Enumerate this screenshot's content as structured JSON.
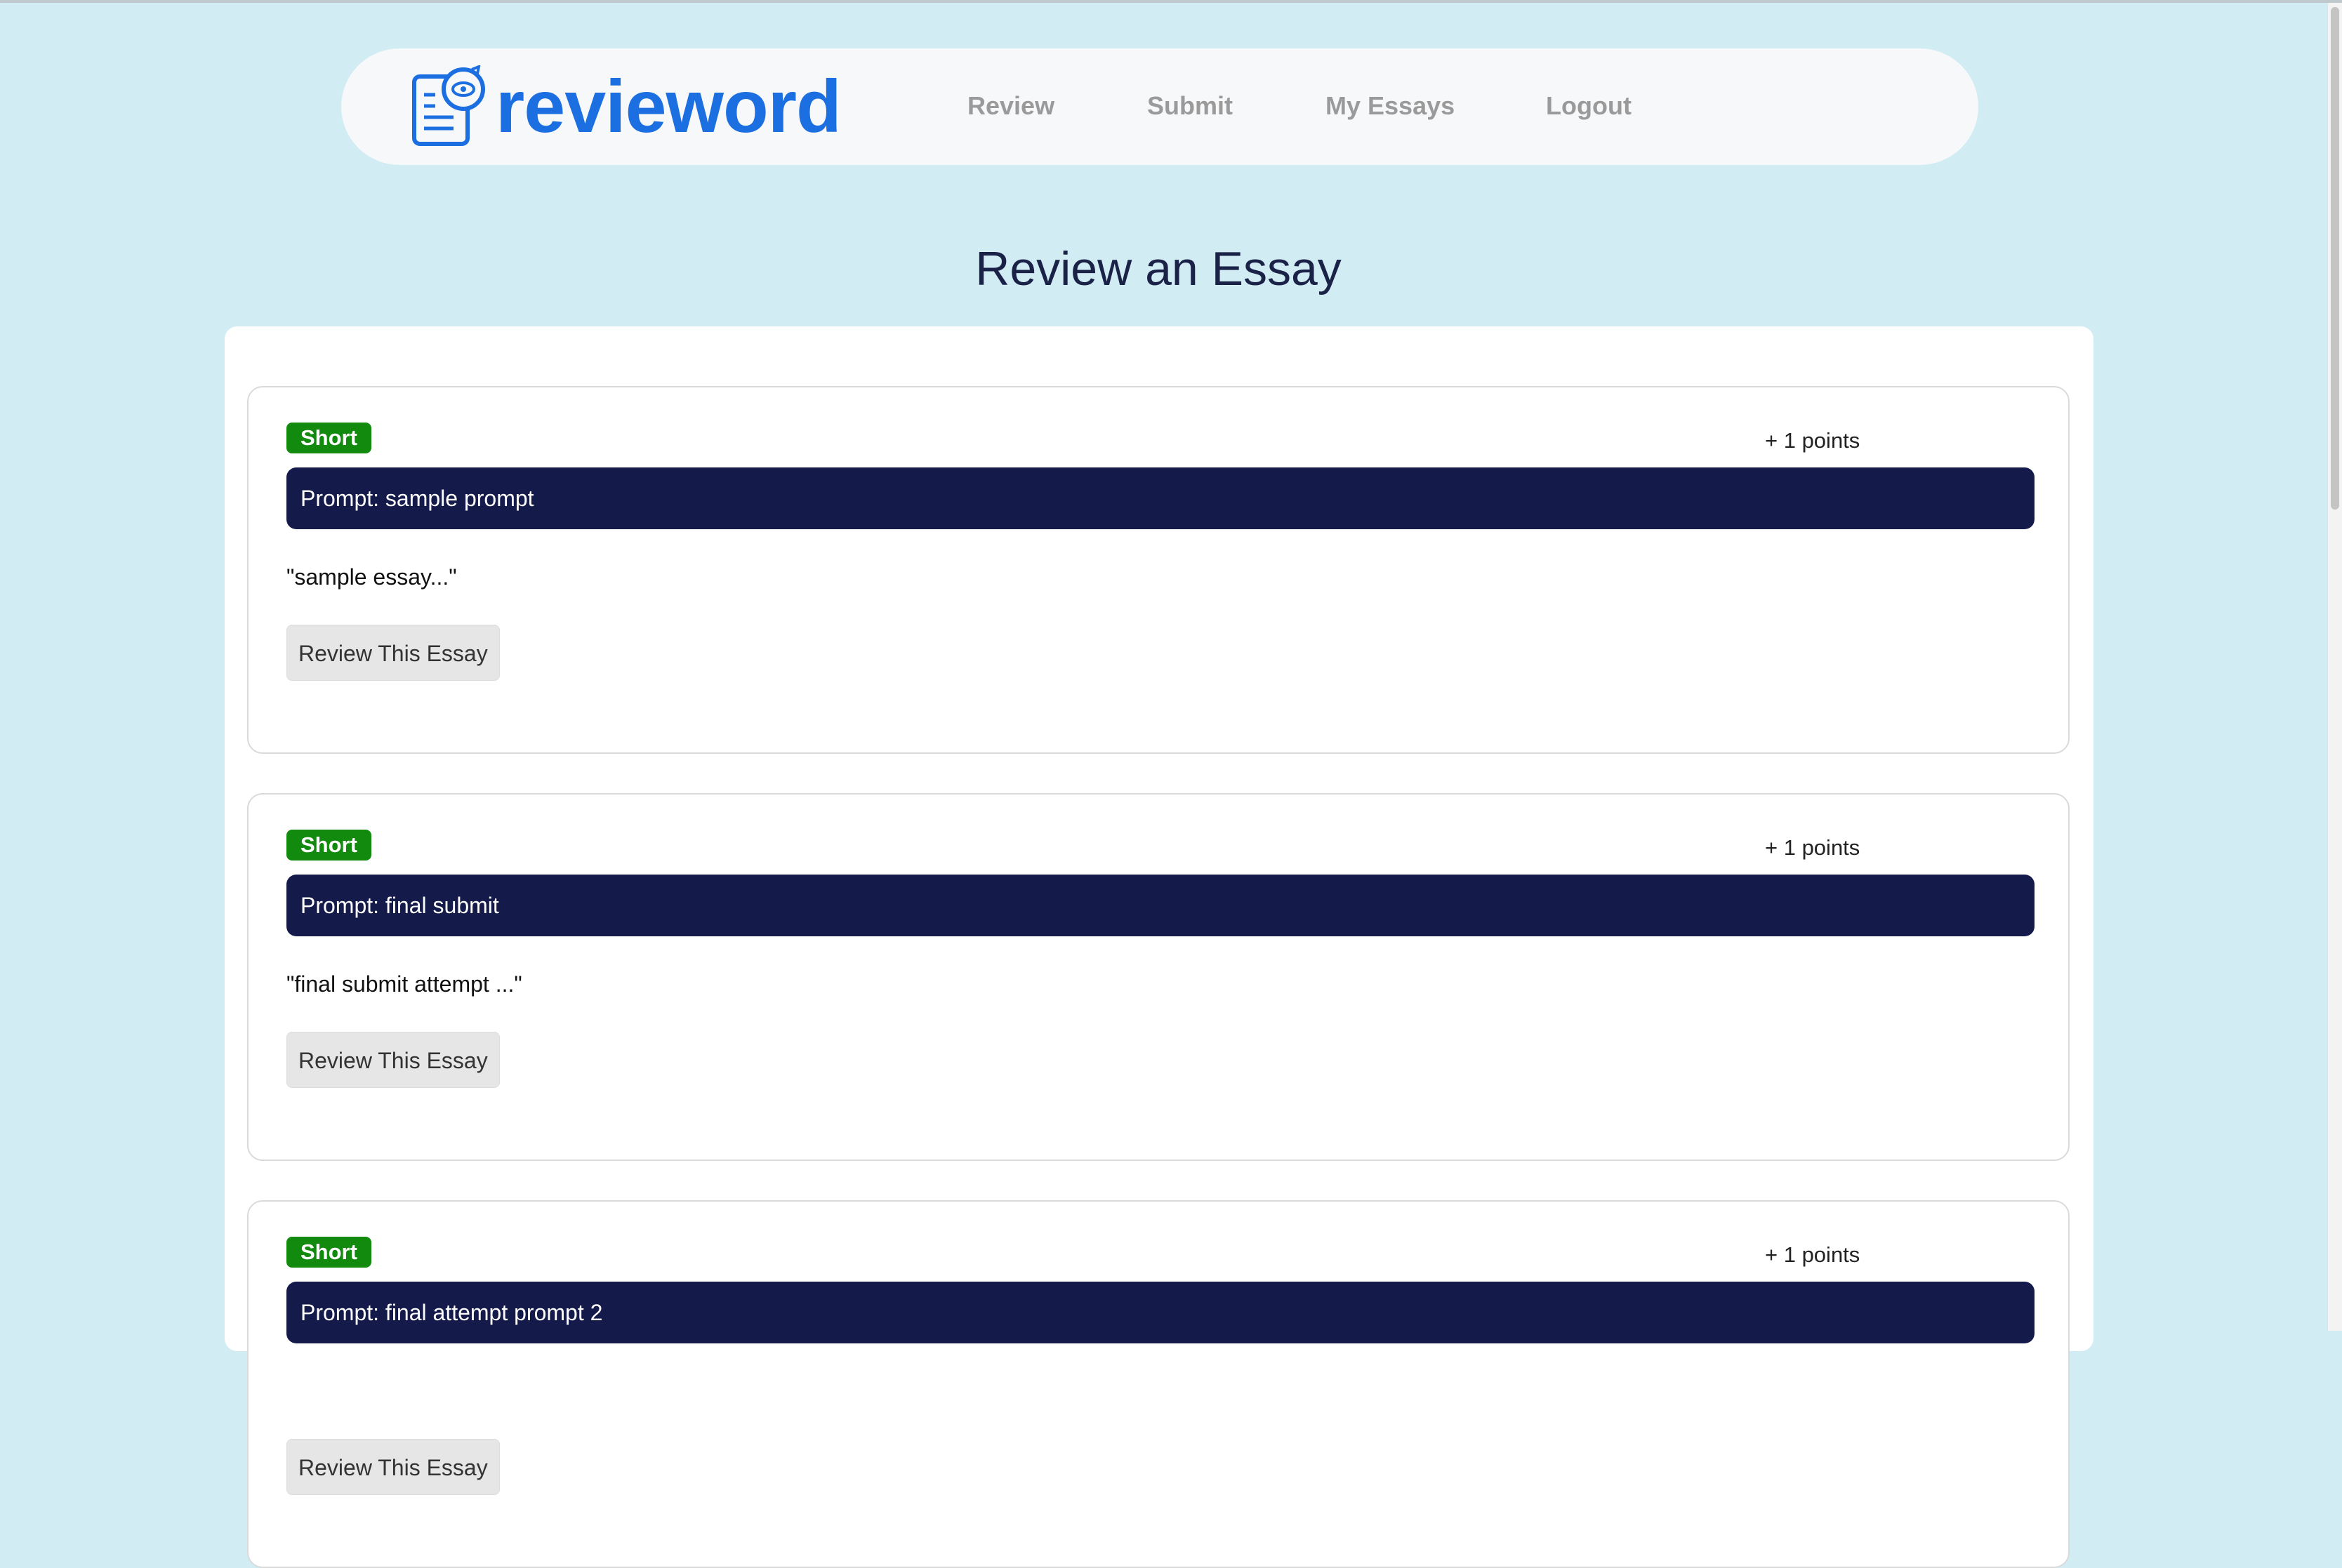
{
  "brand": {
    "name": "revieword",
    "color": "#1b6fe0"
  },
  "nav": {
    "items": [
      {
        "label": "Review"
      },
      {
        "label": "Submit"
      },
      {
        "label": "My Essays"
      },
      {
        "label": "Logout"
      }
    ]
  },
  "page": {
    "title": "Review an Essay"
  },
  "essays": [
    {
      "type": "Short",
      "points": "+ 1 points",
      "prompt": "Prompt: sample prompt",
      "excerpt": "\"sample essay...\"",
      "button": "Review This Essay"
    },
    {
      "type": "Short",
      "points": "+ 1 points",
      "prompt": "Prompt: final submit",
      "excerpt": "\"final submit attempt ...\"",
      "button": "Review This Essay"
    },
    {
      "type": "Short",
      "points": "+ 1 points",
      "prompt": "Prompt: final attempt prompt 2",
      "excerpt": "",
      "button": "Review This Essay"
    }
  ],
  "colors": {
    "background": "#d2ecf4",
    "badge": "#118a0e",
    "prompt_bar": "#141a4a",
    "title": "#1a2347"
  }
}
